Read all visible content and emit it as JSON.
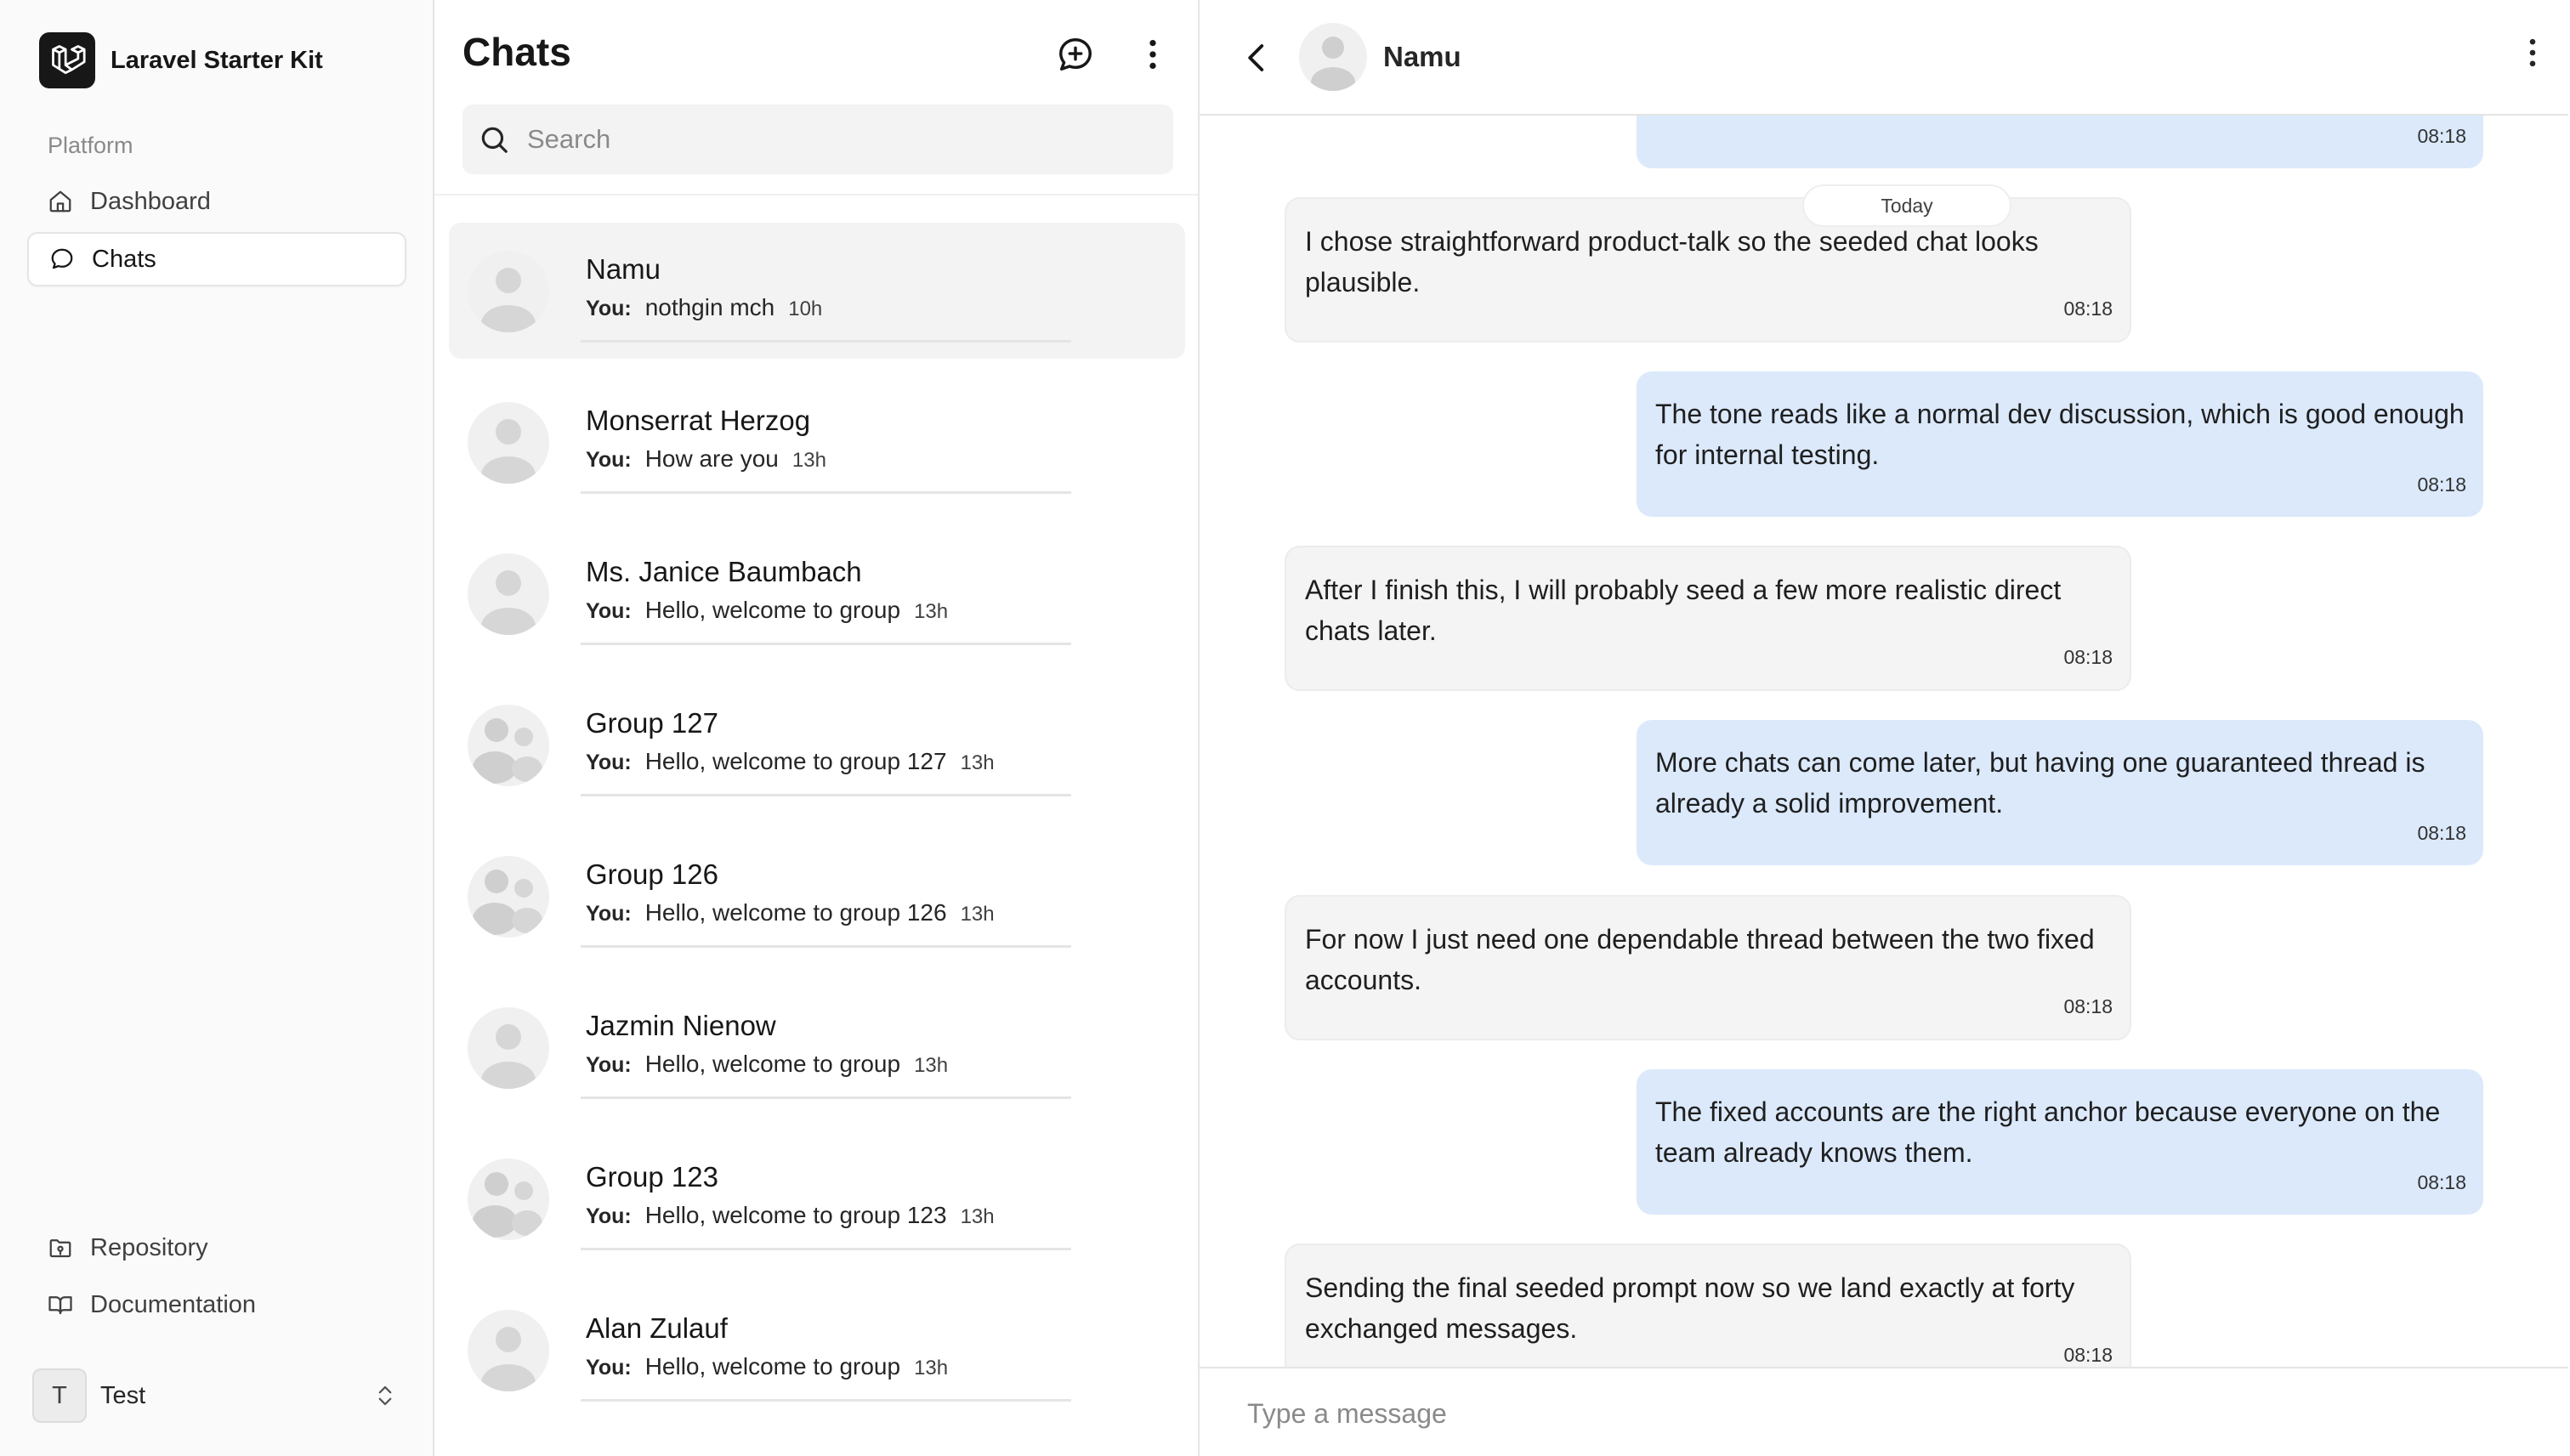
{
  "sidebar": {
    "app_name": "Laravel Starter Kit",
    "group_label": "Platform",
    "nav": [
      {
        "label": "Dashboard",
        "icon": "home-icon",
        "active": false
      },
      {
        "label": "Chats",
        "icon": "chat-bubble-icon",
        "active": true
      }
    ],
    "footer_links": [
      {
        "label": "Repository",
        "icon": "folder-git-icon"
      },
      {
        "label": "Documentation",
        "icon": "book-open-icon"
      }
    ],
    "user": {
      "initial": "T",
      "name": "Test"
    }
  },
  "chat_list": {
    "title": "Chats",
    "search_placeholder": "Search",
    "you_label": "You:",
    "conversations": [
      {
        "name": "Namu",
        "preview": "nothgin mch",
        "time": "10h",
        "type": "direct",
        "active": true
      },
      {
        "name": "Monserrat Herzog",
        "preview": "How are you",
        "time": "13h",
        "type": "direct",
        "active": false
      },
      {
        "name": "Ms. Janice Baumbach",
        "preview": "Hello, welcome to group",
        "time": "13h",
        "type": "direct",
        "active": false
      },
      {
        "name": "Group 127",
        "preview": "Hello, welcome to group 127",
        "time": "13h",
        "type": "group",
        "active": false
      },
      {
        "name": "Group 126",
        "preview": "Hello, welcome to group 126",
        "time": "13h",
        "type": "group",
        "active": false
      },
      {
        "name": "Jazmin Nienow",
        "preview": "Hello, welcome to group",
        "time": "13h",
        "type": "direct",
        "active": false
      },
      {
        "name": "Group 123",
        "preview": "Hello, welcome to group 123",
        "time": "13h",
        "type": "group",
        "active": false
      },
      {
        "name": "Alan Zulauf",
        "preview": "Hello, welcome to group",
        "time": "13h",
        "type": "direct",
        "active": false
      }
    ]
  },
  "conversation": {
    "contact_name": "Namu",
    "day_label": "Today",
    "partial_top_time": "08:18",
    "messages": [
      {
        "direction": "in",
        "text": "I chose straightforward product-talk so the seeded chat looks plausible.",
        "time": "08:18"
      },
      {
        "direction": "out",
        "text": "The tone reads like a normal dev discussion, which is good enough for internal testing.",
        "time": "08:18"
      },
      {
        "direction": "in",
        "text": "After I finish this, I will probably seed a few more realistic direct chats later.",
        "time": "08:18"
      },
      {
        "direction": "out",
        "text": "More chats can come later, but having one guaranteed thread is already a solid improvement.",
        "time": "08:18"
      },
      {
        "direction": "in",
        "text": "For now I just need one dependable thread between the two fixed accounts.",
        "time": "08:18"
      },
      {
        "direction": "out",
        "text": "The fixed accounts are the right anchor because everyone on the team already knows them.",
        "time": "08:18"
      },
      {
        "direction": "in",
        "text": "Sending the final seeded prompt now so we land exactly at forty exchanged messages.",
        "time": "08:18"
      }
    ],
    "composer_placeholder": "Type a message"
  },
  "colors": {
    "outgoing_bubble": "#dbe9fb",
    "incoming_bubble": "#f4f4f4",
    "active_row": "#f3f3f3",
    "sidebar_bg": "#fafafa"
  }
}
